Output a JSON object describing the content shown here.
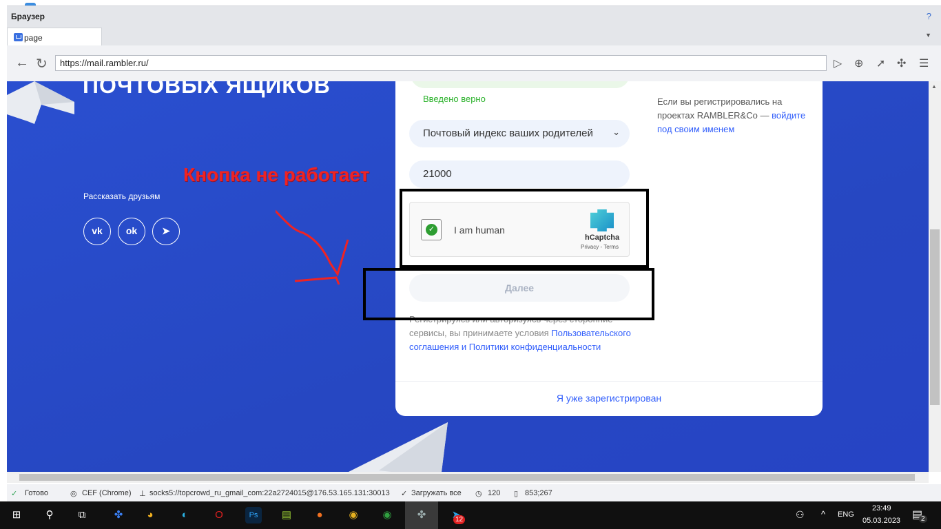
{
  "window": {
    "title": "Браузер",
    "help": "?"
  },
  "tab": {
    "label": "page"
  },
  "toolbar": {
    "url": "https://mail.rambler.ru/"
  },
  "page": {
    "heading": "ПОЧТОВЫХ ЯЩИКОВ",
    "share_label": "Рассказать друзьям",
    "social": [
      "vk",
      "ok",
      "telegram"
    ],
    "annotation": "Кнопка не работает",
    "form": {
      "valid_message": "Введено верно",
      "secret_question": "Почтовый индекс ваших родителей",
      "answer_value": "21000",
      "captcha": {
        "label": "I am human",
        "brand": "hCaptcha",
        "links": "Privacy - Terms"
      },
      "next_button": "Далее",
      "legal_text": "Регистрируясь или авторизуясь через сторонние сервисы, вы принимаете условия",
      "legal_link": "Пользовательского соглашения и Политики конфиденциальности",
      "already_registered": "Я уже зарегистрирован"
    },
    "side": {
      "text": "Если вы регистрировались на проектах RAMBLER&Co —",
      "link": "войдите под своим именем"
    }
  },
  "status": {
    "ready": "Готово",
    "engine": "CEF (Chrome)",
    "proxy": "socks5://topcrowd_ru_gmail_com:22a2724015@176.53.165.131:30013",
    "load": "Загружать все",
    "timeout": "120",
    "coords": "853;267"
  },
  "taskbar": {
    "lang": "ENG",
    "time": "23:49",
    "date": "05.03.2023",
    "telegram_badge": "12",
    "notif_badge": "2"
  },
  "colors": {
    "accent": "#315efb",
    "bg": "#2647c2",
    "annotation": "#ef2323"
  }
}
